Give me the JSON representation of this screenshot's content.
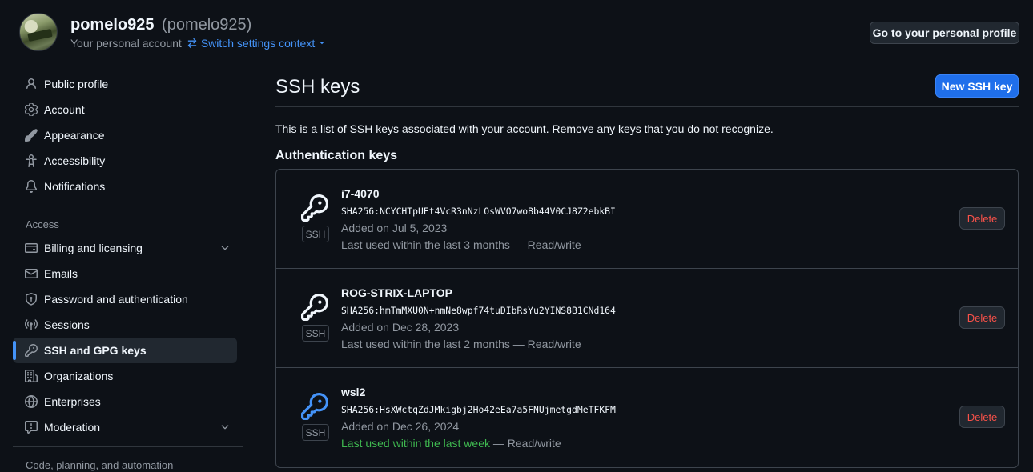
{
  "header": {
    "username": "pomelo925",
    "login": "(pomelo925)",
    "subtitle": "Your personal account",
    "switch_label": "Switch settings context",
    "profile_button": "Go to your personal profile"
  },
  "sidebar": {
    "top_items": [
      {
        "label": "Public profile",
        "icon": "person-icon"
      },
      {
        "label": "Account",
        "icon": "gear-icon"
      },
      {
        "label": "Appearance",
        "icon": "paintbrush-icon"
      },
      {
        "label": "Accessibility",
        "icon": "accessibility-icon"
      },
      {
        "label": "Notifications",
        "icon": "bell-icon"
      }
    ],
    "access_title": "Access",
    "access_items": [
      {
        "label": "Billing and licensing",
        "icon": "credit-card-icon"
      },
      {
        "label": "Emails",
        "icon": "mail-icon"
      },
      {
        "label": "Password and authentication",
        "icon": "shield-lock-icon"
      },
      {
        "label": "Sessions",
        "icon": "broadcast-icon"
      },
      {
        "label": "SSH and GPG keys",
        "icon": "key-icon"
      },
      {
        "label": "Organizations",
        "icon": "organization-icon"
      },
      {
        "label": "Enterprises",
        "icon": "globe-icon"
      },
      {
        "label": "Moderation",
        "icon": "report-icon"
      }
    ],
    "next_group_title": "Code, planning, and automation"
  },
  "main": {
    "title": "SSH keys",
    "new_button": "New SSH key",
    "description": "This is a list of SSH keys associated with your account. Remove any keys that you do not recognize.",
    "section_title": "Authentication keys",
    "keys": [
      {
        "name": "i7-4070",
        "fingerprint": "SHA256:NCYCHTpUEt4VcR3nNzLOsWVO7woBb44V0CJ8Z2ebkBI",
        "added": "Added on Jul 5, 2023",
        "used": "Last used within the last 3 months",
        "access": "— Read/write",
        "badge": "SSH",
        "delete": "Delete",
        "recent": false
      },
      {
        "name": "ROG-STRIX-LAPTOP",
        "fingerprint": "SHA256:hmTmMXU0N+nmNe8wpf74tuDIbRsYu2YINS8B1CNd164",
        "added": "Added on Dec 28, 2023",
        "used": "Last used within the last 2 months",
        "access": "— Read/write",
        "badge": "SSH",
        "delete": "Delete",
        "recent": false
      },
      {
        "name": "wsl2",
        "fingerprint": "SHA256:HsXWctqZdJMkigbj2Ho42eEa7a5FNUjmetgdMeTFKFM",
        "added": "Added on Dec 26, 2024",
        "used": "Last used within the last week",
        "access": "— Read/write",
        "badge": "SSH",
        "delete": "Delete",
        "recent": true
      }
    ]
  },
  "colors": {
    "background": "#0d1117",
    "accent": "#4493f8",
    "primary_button": "#1f6feb",
    "danger": "#f85149",
    "recent_green": "#3fb950"
  }
}
